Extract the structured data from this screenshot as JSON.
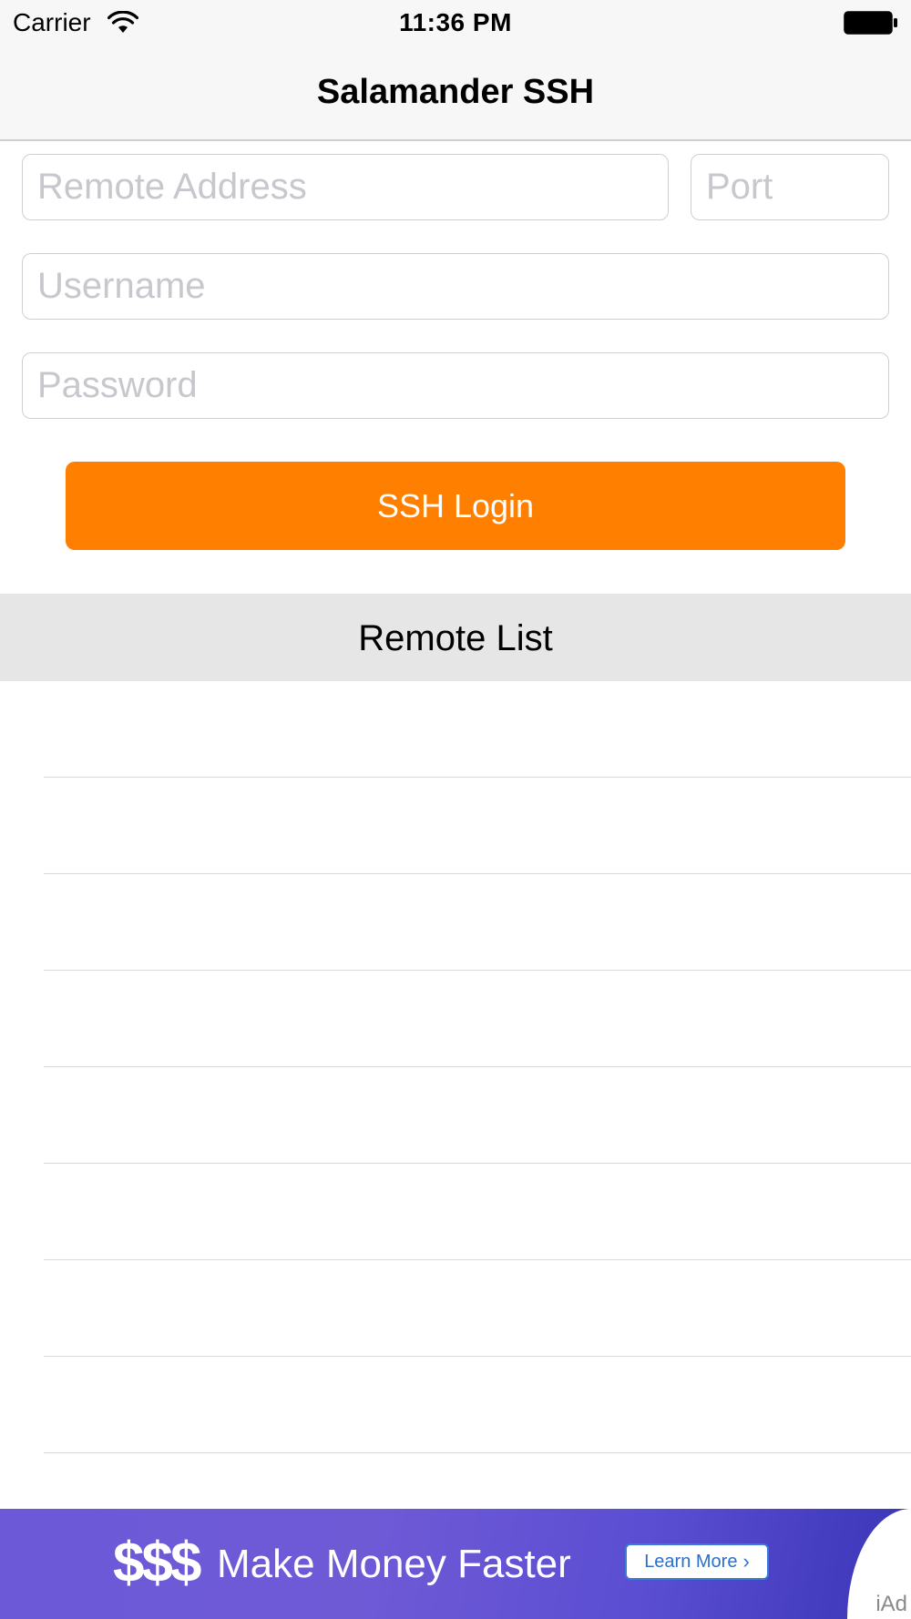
{
  "status_bar": {
    "carrier": "Carrier",
    "time": "11:36 PM"
  },
  "nav": {
    "title": "Salamander SSH"
  },
  "form": {
    "remote_address_placeholder": "Remote Address",
    "port_placeholder": "Port",
    "username_placeholder": "Username",
    "password_placeholder": "Password",
    "login_label": "SSH Login"
  },
  "remote_list": {
    "header": "Remote List",
    "items": [
      "",
      "",
      "",
      "",
      "",
      "",
      "",
      ""
    ]
  },
  "ad": {
    "dollars": "$$$",
    "headline": "Make Money Faster",
    "cta": "Learn More",
    "badge": "iAd"
  },
  "colors": {
    "accent": "#ff7f00",
    "nav_bg": "#f7f7f7",
    "list_header_bg": "#e6e6e6",
    "ad_bg": "#6b59d8"
  },
  "icons": [
    "wifi-icon",
    "battery-icon",
    "chevron-right-icon"
  ]
}
